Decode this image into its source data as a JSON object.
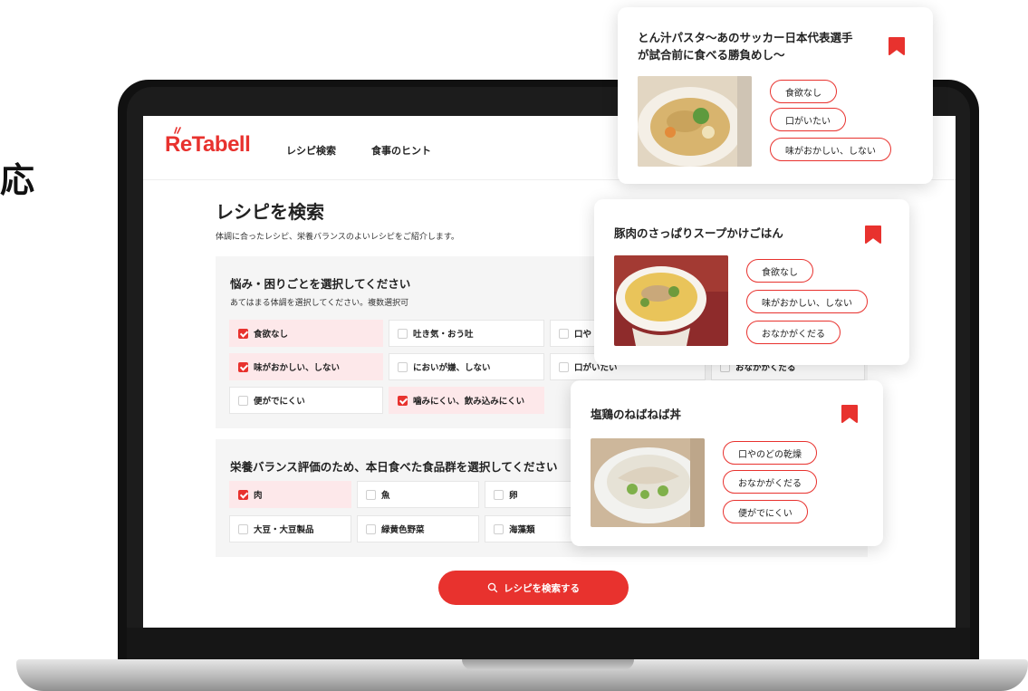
{
  "side_text": "応",
  "app": {
    "logo": "ReTabell",
    "nav": [
      "レシピ検索",
      "食事のヒント"
    ]
  },
  "page": {
    "title": "レシピを検索",
    "subtitle": "体調に合ったレシピ、栄養バランスのよいレシピをご紹介します。"
  },
  "section1": {
    "title": "悩み・困りごとを選択してください",
    "subtitle": "あてはまる体調を選択してください。複数選択可",
    "options": [
      {
        "label": "食欲なし",
        "checked": true
      },
      {
        "label": "吐き気・おう吐",
        "checked": false
      },
      {
        "label": "口や",
        "checked": false
      },
      {
        "label": "味がおかしい、しない",
        "checked": true
      },
      {
        "label": "においが嫌、しない",
        "checked": false
      },
      {
        "label": "口がいたい",
        "checked": false
      },
      {
        "label": "おなかがくだる",
        "checked": false
      },
      {
        "label": "便がでにくい",
        "checked": false
      },
      {
        "label": "噛みにくい、飲み込みにくい",
        "checked": true
      }
    ]
  },
  "section2": {
    "title": "栄養バランス評価のため、本日食べた食品群を選択してください",
    "options": [
      {
        "label": "肉",
        "checked": true
      },
      {
        "label": "魚",
        "checked": false
      },
      {
        "label": "卵",
        "checked": false
      },
      {
        "label": "大豆・大豆製品",
        "checked": false
      },
      {
        "label": "緑黄色野菜",
        "checked": false
      },
      {
        "label": "海藻類",
        "checked": false
      }
    ]
  },
  "search_button": "レシピを検索する",
  "cards": [
    {
      "title_line1": "とん汁パスタ〜あのサッカー日本代表選手",
      "title_line2": "が試合前に食べる勝負めし〜",
      "tags": [
        "食欲なし",
        "口がいたい",
        "味がおかしい、しない"
      ]
    },
    {
      "title_line1": "豚肉のさっぱりスープかけごはん",
      "tags": [
        "食欲なし",
        "味がおかしい、しない",
        "おなかがくだる"
      ]
    },
    {
      "title_line1": "塩鶏のねばねば丼",
      "tags": [
        "口やのどの乾燥",
        "おなかがくだる",
        "便がでにくい"
      ]
    }
  ],
  "colors": {
    "brand_red": "#e8322e",
    "checked_bg": "#fde8ea",
    "section_bg": "#f5f5f5"
  },
  "icons": {
    "bookmark": "bookmark-icon",
    "search": "search-icon",
    "checkbox": "checkbox-icon"
  }
}
